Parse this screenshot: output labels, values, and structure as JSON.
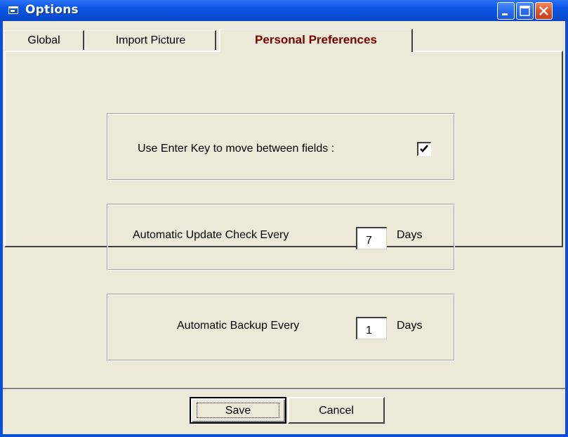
{
  "window": {
    "title": "Options"
  },
  "tabs": [
    {
      "label": "Global",
      "mnemonic": "G"
    },
    {
      "label": "Import Picture",
      "mnemonic": "I"
    },
    {
      "label": "Personal Preferences",
      "mnemonic": "P",
      "active": true
    }
  ],
  "preferences": {
    "enter_key_label": "Use Enter Key to move between fields :",
    "enter_key_checked": true,
    "update_label": "Automatic Update Check Every",
    "update_value": "7",
    "update_unit": "Days",
    "backup_label": "Automatic Backup Every",
    "backup_value": "1",
    "backup_unit": "Days"
  },
  "buttons": {
    "save": "Save",
    "cancel": "Cancel"
  },
  "colors": {
    "titlebar": "#0a4fd6",
    "active_tab_text": "#7a0000",
    "dialog_bg": "#ece9d8"
  }
}
